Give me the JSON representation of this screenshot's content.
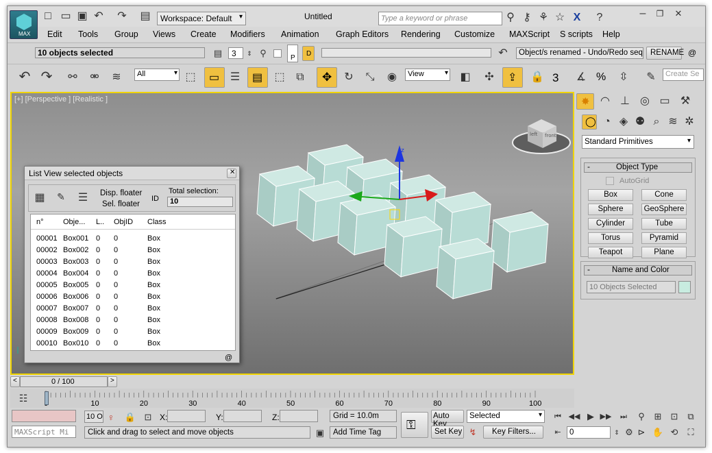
{
  "app": {
    "title": "Untitled",
    "logo_label": "MAX",
    "workspace": "Workspace: Default",
    "search_placeholder": "Type a keyword or phrase"
  },
  "menu": [
    "Edit",
    "Tools",
    "Group",
    "Views",
    "Create",
    "Modifiers",
    "Animation",
    "Graph Editors",
    "Rendering",
    "Customize",
    "MAXScript",
    "S scripts",
    "Help"
  ],
  "toolbar2": {
    "selection_status": "10 objects selected",
    "spinner_value": "3",
    "p_label": "P",
    "d_label": "D",
    "rename_status": "Object/s renamed - Undo/Redo seque",
    "rename_button": "RENAME",
    "at": "@"
  },
  "toolbar3": {
    "filter": "All",
    "refcoord": "View",
    "create_sel_placeholder": "Create Se",
    "snap_3": "3",
    "pct": "%"
  },
  "viewport": {
    "label": "[+] [Perspective ] [Realistic ]",
    "cube_left": "left",
    "cube_front": "front"
  },
  "floater": {
    "title": "List View selected objects",
    "disp": "Disp. floater",
    "sel": "Sel. floater",
    "id": "ID",
    "total_label": "Total selection:",
    "total_value": "10",
    "footer": "@",
    "columns": [
      "n°",
      "Obje...",
      "L..",
      "ObjID",
      "Class"
    ],
    "rows": [
      [
        "00001",
        "Box001",
        "0",
        "0",
        "Box"
      ],
      [
        "00002",
        "Box002",
        "0",
        "0",
        "Box"
      ],
      [
        "00003",
        "Box003",
        "0",
        "0",
        "Box"
      ],
      [
        "00004",
        "Box004",
        "0",
        "0",
        "Box"
      ],
      [
        "00005",
        "Box005",
        "0",
        "0",
        "Box"
      ],
      [
        "00006",
        "Box006",
        "0",
        "0",
        "Box"
      ],
      [
        "00007",
        "Box007",
        "0",
        "0",
        "Box"
      ],
      [
        "00008",
        "Box008",
        "0",
        "0",
        "Box"
      ],
      [
        "00009",
        "Box009",
        "0",
        "0",
        "Box"
      ],
      [
        "00010",
        "Box010",
        "0",
        "0",
        "Box"
      ]
    ]
  },
  "command_panel": {
    "category": "Standard Primitives",
    "object_type_title": "Object Type",
    "autogrid": "AutoGrid",
    "primitives": [
      "Box",
      "Cone",
      "Sphere",
      "GeoSphere",
      "Cylinder",
      "Tube",
      "Torus",
      "Pyramid",
      "Teapot",
      "Plane"
    ],
    "name_color_title": "Name and Color",
    "name_value": "10 Objects Selected",
    "color": "#c8ece0"
  },
  "timeline": {
    "frame": "0 / 100",
    "ticks": [
      "0",
      "10",
      "20",
      "30",
      "40",
      "50",
      "60",
      "70",
      "80",
      "90",
      "100"
    ]
  },
  "status": {
    "maxscript": "MAXScript Mi",
    "count": "10 O",
    "x_label": "X:",
    "y_label": "Y:",
    "z_label": "Z:",
    "grid": "Grid = 10.0m",
    "prompt": "Click and drag to select and move objects",
    "add_time_tag": "Add Time Tag",
    "auto_key": "Auto Key",
    "set_key": "Set Key",
    "key_mode": "Selected",
    "key_filters": "Key Filters...",
    "frame_value": "0"
  },
  "colors": {
    "selection": "#f0d400",
    "box_face": "#b8dcd5",
    "accent": "#f0b400"
  }
}
